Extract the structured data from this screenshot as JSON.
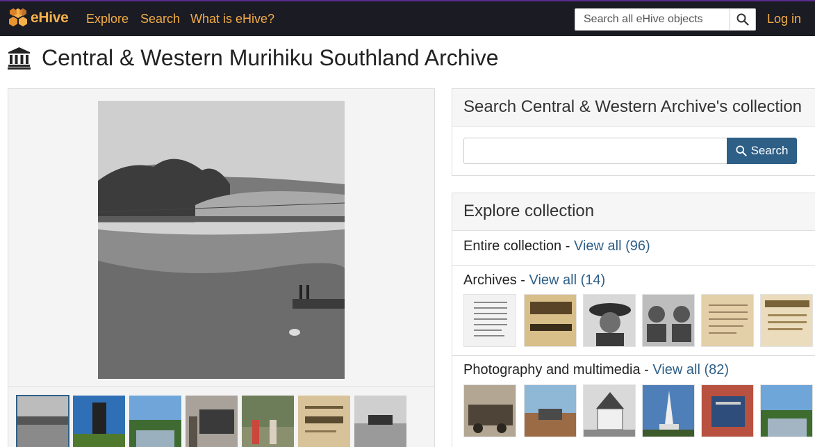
{
  "nav": {
    "brand": "eHive",
    "links": [
      "Explore",
      "Search",
      "What is eHive?"
    ],
    "search_placeholder": "Search all eHive objects",
    "login": "Log in"
  },
  "page": {
    "title": "Central & Western Murihiku Southland Archive"
  },
  "collection_search": {
    "heading": "Search Central & Western Archive's collection",
    "button": "Search"
  },
  "explore": {
    "heading": "Explore collection",
    "entire": {
      "label": "Entire collection - ",
      "link": "View all (96)"
    },
    "archives": {
      "label": "Archives - ",
      "link": "View all (14)"
    },
    "photography": {
      "label": "Photography and multimedia - ",
      "link": "View all (82)"
    }
  },
  "icons": [
    "ehive-logo-icon",
    "search-icon",
    "museum-icon"
  ],
  "colors": {
    "nav_bg": "#1b1b24",
    "nav_link": "#f2ad45",
    "accent": "#2e5f87",
    "nav_top_border": "#5b2c91"
  }
}
